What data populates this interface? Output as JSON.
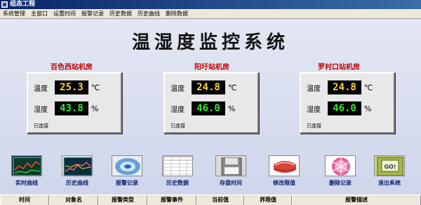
{
  "window": {
    "title": "组态工程"
  },
  "menu": [
    "系统管理",
    "主窗口",
    "设置时间",
    "报警记录",
    "历史数据",
    "历史曲线",
    "删除数据"
  ],
  "page_title": "温湿度监控系统",
  "stations": [
    {
      "name": "百色西站机房",
      "temp_label": "温度",
      "temp": "25.3",
      "temp_unit": "℃",
      "hum_label": "湿度",
      "hum": "43.8",
      "hum_unit": "%",
      "status": "已连接"
    },
    {
      "name": "阳圩站机房",
      "temp_label": "温度",
      "temp": "24.8",
      "temp_unit": "℃",
      "hum_label": "湿度",
      "hum": "46.0",
      "hum_unit": "%",
      "status": "已连接"
    },
    {
      "name": "罗村口站机房",
      "temp_label": "温度",
      "temp": "24.8",
      "temp_unit": "℃",
      "hum_label": "湿度",
      "hum": "46.0",
      "hum_unit": "%",
      "status": "已连接"
    }
  ],
  "buttons": [
    {
      "label": "实时曲线",
      "icon": "realtime-curve-icon"
    },
    {
      "label": "历史曲线",
      "icon": "history-curve-icon"
    },
    {
      "label": "报警记录",
      "icon": "alarm-record-icon"
    },
    {
      "label": "历史数据",
      "icon": "history-data-icon"
    },
    {
      "label": "存盘时间",
      "icon": "save-time-icon"
    },
    {
      "label": "修改限值",
      "icon": "modify-limit-icon"
    },
    {
      "label": "删除记录",
      "icon": "delete-record-icon"
    },
    {
      "label": "退出系统",
      "icon": "exit-icon"
    }
  ],
  "exit_sign": "GO!",
  "alarm_table": {
    "columns": [
      "时间",
      "对象名",
      "报警类型",
      "报警事件",
      "当前值",
      "界限值",
      "报警描述"
    ]
  },
  "colors": {
    "station_name": "#c00000",
    "temp_value": "#ffd22e",
    "hum_value": "#35e435"
  }
}
